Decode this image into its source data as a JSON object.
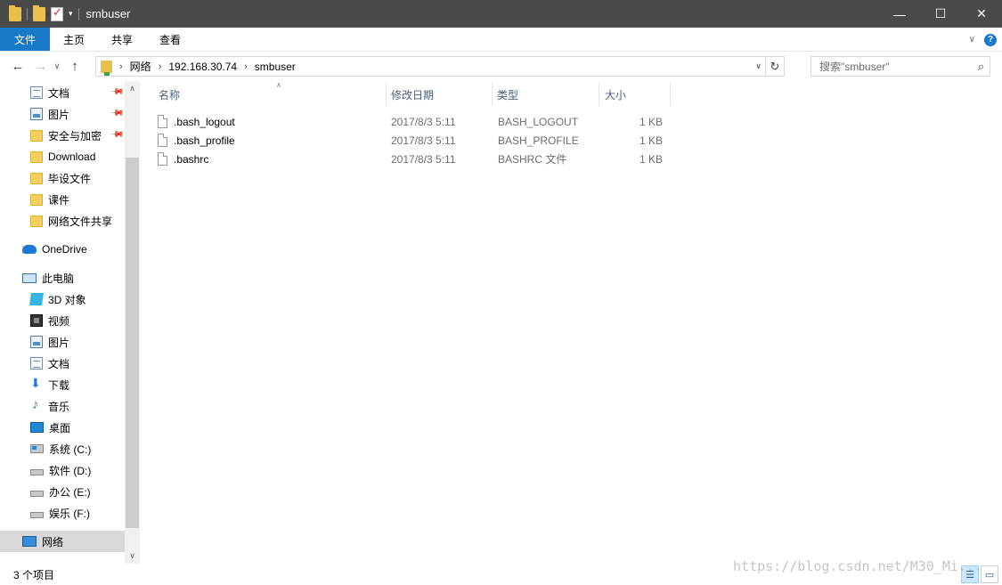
{
  "window": {
    "title": "smbuser",
    "minimize": "—",
    "maximize": "☐",
    "close": "✕"
  },
  "ribbon": {
    "tabs": [
      "文件",
      "主页",
      "共享",
      "查看"
    ],
    "help": "?",
    "collapse": "∨"
  },
  "address": {
    "crumbs": [
      "网络",
      "192.168.30.74",
      "smbuser"
    ],
    "back": "←",
    "forward": "→",
    "recent": "∨",
    "up": "↑",
    "dropdown": "∨",
    "refresh": "↻"
  },
  "search": {
    "placeholder": "搜索\"smbuser\"",
    "icon": "⌕"
  },
  "sidebar": {
    "quick_access": [
      {
        "label": "文档",
        "icon": "doc-icon",
        "pinned": true
      },
      {
        "label": "图片",
        "icon": "picture-icon",
        "pinned": true
      },
      {
        "label": "安全与加密",
        "icon": "folder-icon",
        "pinned": true
      },
      {
        "label": "Download",
        "icon": "folder-icon",
        "pinned": false
      },
      {
        "label": "毕设文件",
        "icon": "folder-icon",
        "pinned": false
      },
      {
        "label": "课件",
        "icon": "folder-icon",
        "pinned": false
      },
      {
        "label": "网络文件共享",
        "icon": "folder-icon",
        "pinned": false
      }
    ],
    "onedrive": "OneDrive",
    "this_pc": "此电脑",
    "pc_items": [
      {
        "label": "3D 对象",
        "icon": "cube-icon"
      },
      {
        "label": "视频",
        "icon": "video-icon"
      },
      {
        "label": "图片",
        "icon": "picture-icon"
      },
      {
        "label": "文档",
        "icon": "doc-icon"
      },
      {
        "label": "下载",
        "icon": "download-icon"
      },
      {
        "label": "音乐",
        "icon": "music-icon"
      },
      {
        "label": "桌面",
        "icon": "desktop-icon"
      },
      {
        "label": "系统 (C:)",
        "icon": "system-drive-icon"
      },
      {
        "label": "软件 (D:)",
        "icon": "drive-icon"
      },
      {
        "label": "办公 (E:)",
        "icon": "drive-icon"
      },
      {
        "label": "娱乐 (F:)",
        "icon": "drive-icon"
      }
    ],
    "network": "网络",
    "scroll_up": "∧",
    "scroll_down": "∨"
  },
  "columns": {
    "name": "名称",
    "date": "修改日期",
    "type": "类型",
    "size": "大小",
    "sort_indicator": "∧"
  },
  "files": [
    {
      "name": ".bash_logout",
      "date": "2017/8/3 5:11",
      "type": "BASH_LOGOUT",
      "size": "1 KB"
    },
    {
      "name": ".bash_profile",
      "date": "2017/8/3 5:11",
      "type": "BASH_PROFILE",
      "size": "1 KB"
    },
    {
      "name": ".bashrc",
      "date": "2017/8/3 5:11",
      "type": "BASHRC 文件",
      "size": "1 KB"
    }
  ],
  "status": {
    "count": "3 个项目",
    "details_view": "☰",
    "icons_view": "▭"
  },
  "watermark": "https://blog.csdn.net/M30_Mi..."
}
